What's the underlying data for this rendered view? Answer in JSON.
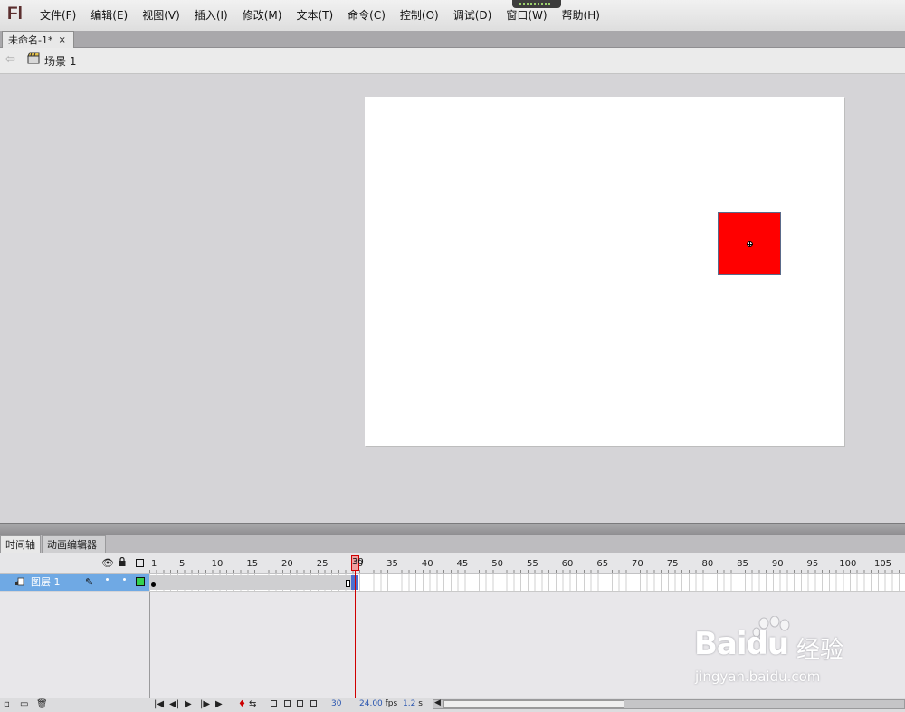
{
  "app": {
    "logo": "Fl"
  },
  "menu": [
    "文件(F)",
    "编辑(E)",
    "视图(V)",
    "插入(I)",
    "修改(M)",
    "文本(T)",
    "命令(C)",
    "控制(O)",
    "调试(D)",
    "窗口(W)",
    "帮助(H)"
  ],
  "document": {
    "tab_title": "未命名-1*",
    "close_glyph": "×"
  },
  "scene": {
    "label": "场景 1"
  },
  "panels": {
    "timeline_tab": "时间轴",
    "motion_editor_tab": "动画编辑器"
  },
  "timeline": {
    "ruler_labels": [
      "1",
      "5",
      "10",
      "15",
      "20",
      "25",
      "30",
      "35",
      "40",
      "45",
      "50",
      "55",
      "60",
      "65",
      "70",
      "75",
      "80",
      "85",
      "90",
      "95",
      "100",
      "105"
    ],
    "current_frame": 30,
    "layer": {
      "name": "图层 1",
      "color": "#33d14d"
    },
    "frame_readout": "30",
    "fps_readout": "24.00",
    "fps_unit": "fps",
    "time_readout": "1.2",
    "time_unit": "s"
  },
  "stage": {
    "object_color": "#ff0000"
  },
  "watermark": {
    "brand": "Baidu",
    "cn": "经验",
    "url": "jingyan.baidu.com"
  }
}
